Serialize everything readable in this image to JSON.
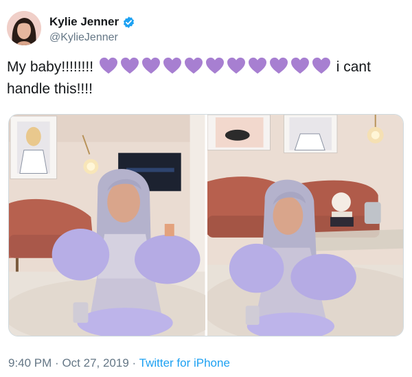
{
  "author": {
    "display_name": "Kylie Jenner",
    "handle": "@KylieJenner",
    "verified": true,
    "avatar_icon": "profile-photo"
  },
  "tweet": {
    "text_before": "My baby!!!!!!!!",
    "emoji": "purple-heart",
    "emoji_count": 11,
    "text_after": "i cant handle this!!!!"
  },
  "media": [
    {
      "icon": "photo-child-in-lavender-dress-left"
    },
    {
      "icon": "photo-child-in-lavender-dress-right"
    }
  ],
  "meta": {
    "time": "9:40 PM",
    "separator": "·",
    "date": "Oct 27, 2019",
    "source": "Twitter for iPhone"
  },
  "colors": {
    "link": "#1da1f2",
    "secondary_text": "#657786",
    "heart": "#a77fd1"
  }
}
